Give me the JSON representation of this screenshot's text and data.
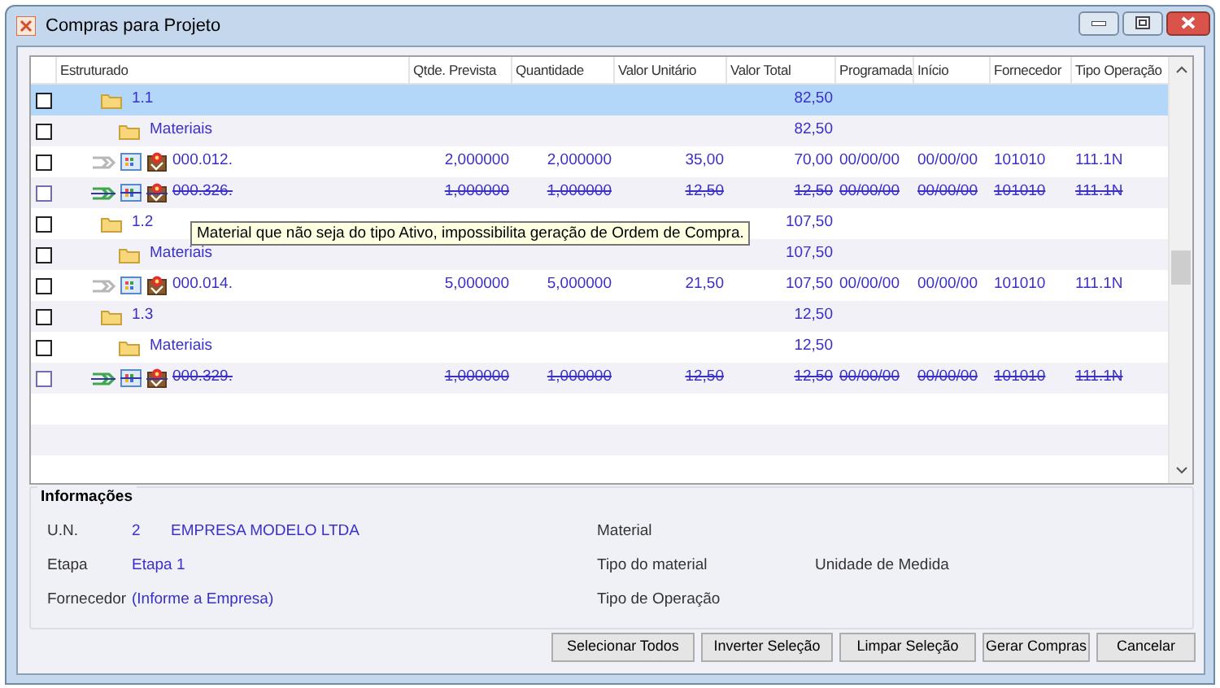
{
  "window": {
    "title": "Compras para Projeto"
  },
  "table": {
    "columns": [
      "Estruturado",
      "Qtde. Prevista",
      "Quantidade",
      "Valor Unitário",
      "Valor Total",
      "Programada",
      "Início",
      "Fornecedor",
      "Tipo Operação"
    ],
    "rows": [
      {
        "kind": "folder",
        "label": "1.1",
        "selected": true,
        "checked": false,
        "disabled": false,
        "valor_total": "82,50",
        "children": [
          {
            "kind": "folder",
            "label": "Materiais",
            "selected": false,
            "checked": false,
            "disabled": false,
            "valor_total": "82,50",
            "children": [
              {
                "kind": "item",
                "label": "000.012.",
                "selected": false,
                "checked": false,
                "disabled": false,
                "values": [
                  "2,000000",
                  "2,000000",
                  "35,00",
                  "70,00",
                  "00/00/00",
                  "00/00/00",
                  "101010",
                  "111.1N"
                ]
              },
              {
                "kind": "item",
                "label": "000.326.",
                "selected": false,
                "checked": false,
                "disabled": true,
                "values": [
                  "1,000000",
                  "1,000000",
                  "12,50",
                  "12,50",
                  "00/00/00",
                  "00/00/00",
                  "101010",
                  "111.1N"
                ]
              }
            ]
          }
        ]
      },
      {
        "kind": "folder",
        "label": "1.2",
        "selected": false,
        "checked": false,
        "disabled": false,
        "valor_total": "107,50",
        "children": [
          {
            "kind": "folder",
            "label": "Materiais",
            "selected": false,
            "checked": false,
            "disabled": false,
            "valor_total": "107,50",
            "children": [
              {
                "kind": "item",
                "label": "000.014.",
                "selected": false,
                "checked": false,
                "disabled": false,
                "values": [
                  "5,000000",
                  "5,000000",
                  "21,50",
                  "107,50",
                  "00/00/00",
                  "00/00/00",
                  "101010",
                  "111.1N"
                ]
              }
            ]
          }
        ]
      },
      {
        "kind": "folder",
        "label": "1.3",
        "selected": false,
        "checked": false,
        "disabled": false,
        "valor_total": "12,50",
        "children": [
          {
            "kind": "folder",
            "label": "Materiais",
            "selected": false,
            "checked": false,
            "disabled": false,
            "valor_total": "12,50",
            "children": [
              {
                "kind": "item",
                "label": "000.329.",
                "selected": false,
                "checked": false,
                "disabled": true,
                "values": [
                  "1,000000",
                  "1,000000",
                  "12,50",
                  "12,50",
                  "00/00/00",
                  "00/00/00",
                  "101010",
                  "111.1N"
                ]
              }
            ]
          }
        ]
      }
    ]
  },
  "tooltip": {
    "text": "Material que não seja do tipo Ativo, impossibilita geração de Ordem de Compra."
  },
  "info": {
    "title": "Informações",
    "left": [
      {
        "label": "U.N.",
        "values": [
          "2",
          "EMPRESA MODELO LTDA"
        ]
      },
      {
        "label": "Etapa",
        "values": [
          "Etapa 1"
        ]
      },
      {
        "label": "Fornecedor",
        "values": [
          "(Informe a Empresa)"
        ]
      }
    ],
    "right": [
      {
        "labels": [
          "Material"
        ]
      },
      {
        "labels": [
          "Tipo do material",
          "Unidade de Medida"
        ]
      },
      {
        "labels": [
          "Tipo de Operação"
        ]
      }
    ]
  },
  "buttons": [
    "Selecionar Todos",
    "Inverter Seleção",
    "Limpar Seleção",
    "Gerar Compras",
    "Cancelar"
  ]
}
